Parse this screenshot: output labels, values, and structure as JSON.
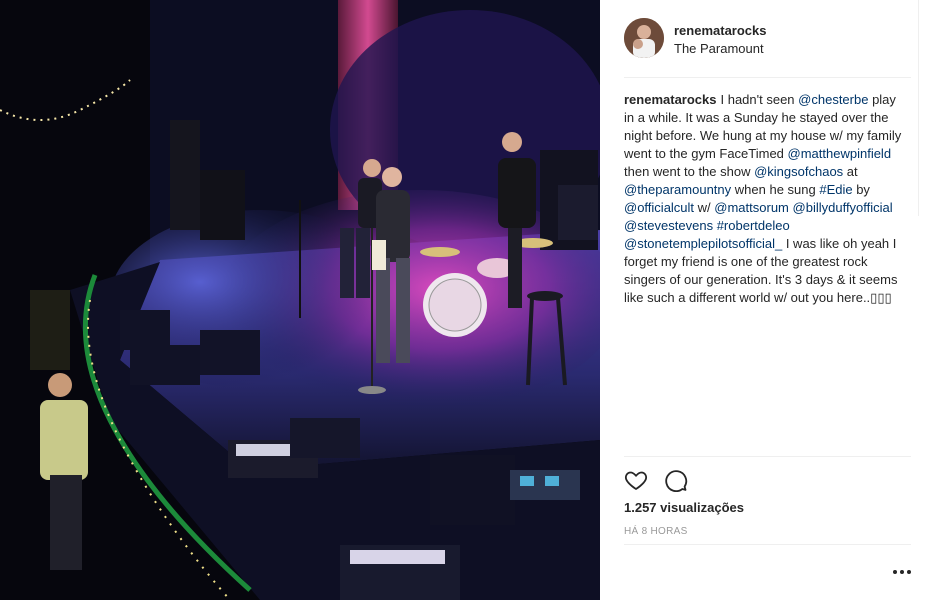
{
  "post": {
    "username": "renematarocks",
    "location": "The Paramount",
    "caption": {
      "user": "renematarocks",
      "segments": [
        {
          "type": "text",
          "text": "I hadn't seen "
        },
        {
          "type": "mention",
          "text": "@chesterbe"
        },
        {
          "type": "text",
          "text": " play in a while. It was a Sunday he stayed over the night before. We hung at my house w/ my family went to the gym FaceTimed "
        },
        {
          "type": "mention",
          "text": "@matthewpinfield"
        },
        {
          "type": "text",
          "text": " then went to the show "
        },
        {
          "type": "mention",
          "text": "@kingsofchaos"
        },
        {
          "type": "text",
          "text": " at "
        },
        {
          "type": "mention",
          "text": "@theparamountny"
        },
        {
          "type": "text",
          "text": " when he sung "
        },
        {
          "type": "hashtag",
          "text": "#Edie"
        },
        {
          "type": "text",
          "text": " by "
        },
        {
          "type": "mention",
          "text": "@officialcult"
        },
        {
          "type": "text",
          "text": " w/ "
        },
        {
          "type": "mention",
          "text": "@mattsorum"
        },
        {
          "type": "text",
          "text": " "
        },
        {
          "type": "mention",
          "text": "@billyduffyofficial"
        },
        {
          "type": "text",
          "text": " "
        },
        {
          "type": "mention",
          "text": "@stevestevens"
        },
        {
          "type": "text",
          "text": " "
        },
        {
          "type": "hashtag",
          "text": "#robertdeleo"
        },
        {
          "type": "text",
          "text": " "
        },
        {
          "type": "mention",
          "text": "@stonetemplepilotsofficial_"
        },
        {
          "type": "text",
          "text": " I was like oh yeah I forget my friend is one of the greatest rock singers of our generation. It's 3 days & it seems like such a different world w/ out you here..▯▯▯"
        }
      ]
    },
    "views": "1.257 visualizações",
    "timestamp": "HÁ 8 HORAS"
  },
  "icons": {
    "like": "heart-icon",
    "comment": "comment-icon",
    "more": "more-options-icon"
  },
  "colors": {
    "link": "#003569",
    "text": "#262626",
    "muted": "#999999",
    "stage_magenta": "#c0309a",
    "stage_blue": "#2a2f8f"
  }
}
